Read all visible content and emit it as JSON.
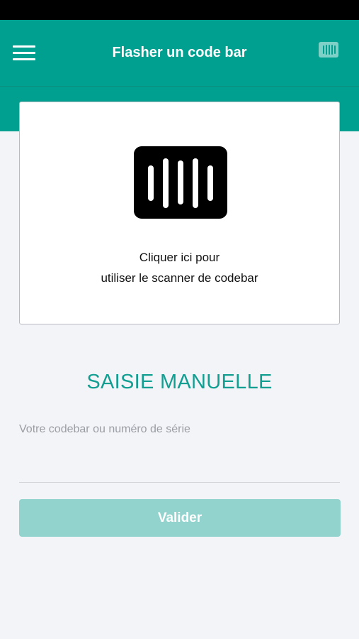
{
  "colors": {
    "status_bar": "#000000",
    "nav_background": "#00a090",
    "page_background": "#f3f4f8",
    "accent_title": "#139e92",
    "button_disabled": "#93d3cd"
  },
  "header": {
    "title": "Flasher un code bar",
    "menu_icon": "hamburger-menu-icon",
    "action_icon": "barcode-icon"
  },
  "scanner_card": {
    "icon": "barcode-scanner-icon",
    "line1": "Cliquer ici pour",
    "line2": "utiliser le scanner de codebar"
  },
  "manual_entry": {
    "title": "SAISIE MANUELLE",
    "input_placeholder": "Votre codebar ou numéro de série",
    "input_value": "",
    "submit_label": "Valider"
  }
}
